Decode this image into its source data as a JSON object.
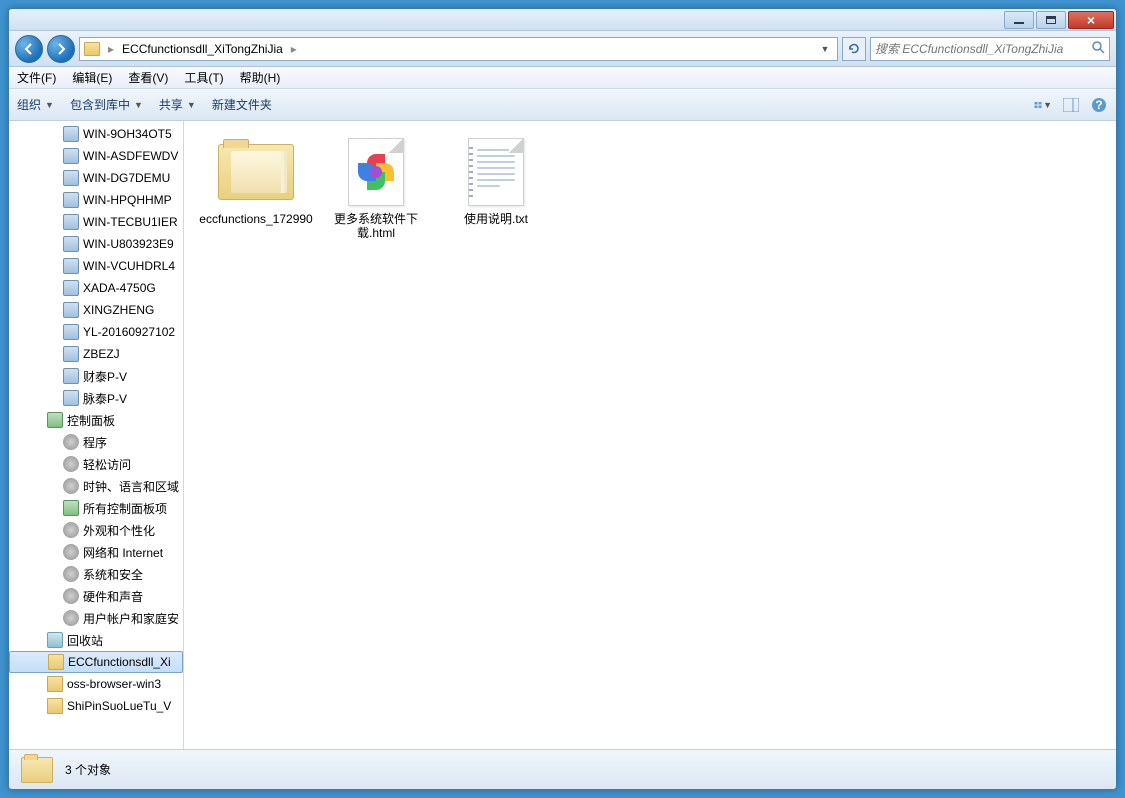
{
  "breadcrumb": {
    "path_item": "ECCfunctionsdll_XiTongZhiJia"
  },
  "search": {
    "placeholder": "搜索 ECCfunctionsdll_XiTongZhiJia"
  },
  "menubar": {
    "file": "文件(F)",
    "edit": "编辑(E)",
    "view": "查看(V)",
    "tools": "工具(T)",
    "help": "帮助(H)"
  },
  "toolbar": {
    "organize": "组织",
    "include": "包含到库中",
    "share": "共享",
    "newfolder": "新建文件夹"
  },
  "sidebar": {
    "items": [
      {
        "label": "WIN-9OH34OT5",
        "icon": "computer",
        "indent": 2,
        "exp": ""
      },
      {
        "label": "WIN-ASDFEWDV",
        "icon": "computer",
        "indent": 2,
        "exp": ""
      },
      {
        "label": "WIN-DG7DEMU",
        "icon": "computer",
        "indent": 2,
        "exp": ""
      },
      {
        "label": "WIN-HPQHHMP",
        "icon": "computer",
        "indent": 2,
        "exp": ""
      },
      {
        "label": "WIN-TECBU1IER",
        "icon": "computer",
        "indent": 2,
        "exp": ""
      },
      {
        "label": "WIN-U803923E9",
        "icon": "computer",
        "indent": 2,
        "exp": ""
      },
      {
        "label": "WIN-VCUHDRL4",
        "icon": "computer",
        "indent": 2,
        "exp": ""
      },
      {
        "label": "XADA-4750G",
        "icon": "computer",
        "indent": 2,
        "exp": ""
      },
      {
        "label": "XINGZHENG",
        "icon": "computer",
        "indent": 2,
        "exp": ""
      },
      {
        "label": "YL-20160927102",
        "icon": "computer",
        "indent": 2,
        "exp": ""
      },
      {
        "label": "ZBEZJ",
        "icon": "computer",
        "indent": 2,
        "exp": ""
      },
      {
        "label": "财泰P-V",
        "icon": "computer",
        "indent": 2,
        "exp": ""
      },
      {
        "label": "脉泰P-V",
        "icon": "computer",
        "indent": 2,
        "exp": ""
      },
      {
        "label": "控制面板",
        "icon": "cpanel",
        "indent": 1,
        "exp": ""
      },
      {
        "label": "程序",
        "icon": "gear",
        "indent": 2,
        "exp": ""
      },
      {
        "label": "轻松访问",
        "icon": "gear",
        "indent": 2,
        "exp": ""
      },
      {
        "label": "时钟、语言和区域",
        "icon": "gear",
        "indent": 2,
        "exp": ""
      },
      {
        "label": "所有控制面板项",
        "icon": "cpanel",
        "indent": 2,
        "exp": ""
      },
      {
        "label": "外观和个性化",
        "icon": "gear",
        "indent": 2,
        "exp": ""
      },
      {
        "label": "网络和 Internet",
        "icon": "gear",
        "indent": 2,
        "exp": ""
      },
      {
        "label": "系统和安全",
        "icon": "gear",
        "indent": 2,
        "exp": ""
      },
      {
        "label": "硬件和声音",
        "icon": "gear",
        "indent": 2,
        "exp": ""
      },
      {
        "label": "用户帐户和家庭安",
        "icon": "gear",
        "indent": 2,
        "exp": ""
      },
      {
        "label": "回收站",
        "icon": "recycle",
        "indent": 1,
        "exp": ""
      },
      {
        "label": "ECCfunctionsdll_Xi",
        "icon": "folder",
        "indent": 1,
        "exp": "",
        "selected": true
      },
      {
        "label": "oss-browser-win3",
        "icon": "folder",
        "indent": 1,
        "exp": ""
      },
      {
        "label": "ShiPinSuoLueTu_V",
        "icon": "folder",
        "indent": 1,
        "exp": ""
      }
    ]
  },
  "files": [
    {
      "name": "eccfunctions_172990",
      "type": "folder"
    },
    {
      "name": "更多系统软件下载.html",
      "type": "html"
    },
    {
      "name": "使用说明.txt",
      "type": "txt"
    }
  ],
  "status": {
    "count_text": "3 个对象"
  }
}
